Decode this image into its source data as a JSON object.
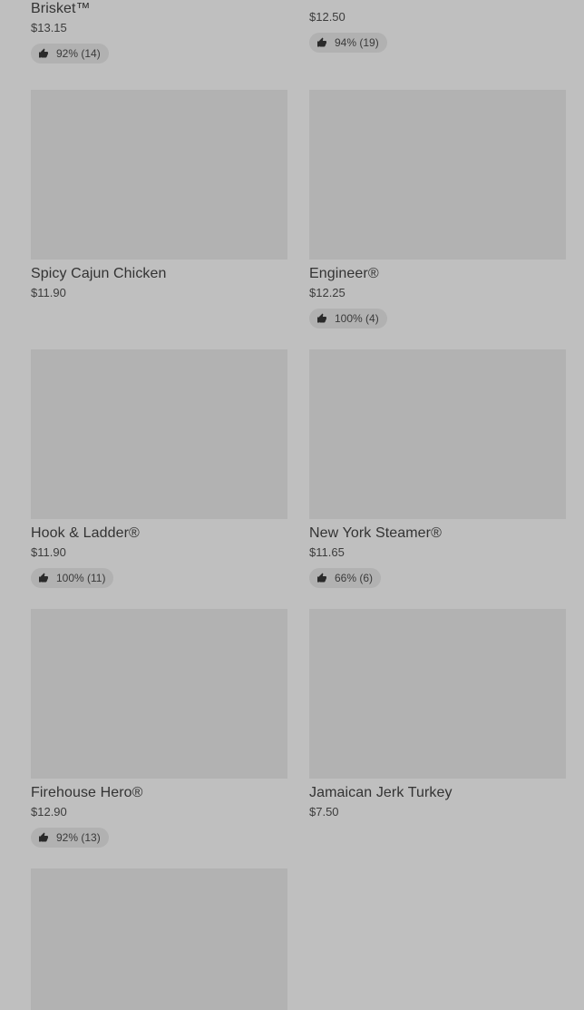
{
  "products": [
    {
      "name": "Brisket™",
      "price": "$13.15",
      "rating": "92% (14)"
    },
    {
      "name": "",
      "price": "$12.50",
      "rating": "94% (19)"
    },
    {
      "name": "Spicy Cajun Chicken",
      "price": "$11.90",
      "rating": null
    },
    {
      "name": "Engineer®",
      "price": "$12.25",
      "rating": "100% (4)"
    },
    {
      "name": "Hook & Ladder®",
      "price": "$11.90",
      "rating": "100% (11)"
    },
    {
      "name": "New York Steamer®",
      "price": "$11.65",
      "rating": "66% (6)"
    },
    {
      "name": "Firehouse Hero®",
      "price": "$12.90",
      "rating": "92% (13)"
    },
    {
      "name": "Jamaican Jerk Turkey",
      "price": "$7.50",
      "rating": null
    }
  ],
  "icons": {
    "rating": "thumbs-up-icon"
  },
  "colors": {
    "background": "#bfbfbf",
    "image_placeholder": "#b2b2b2",
    "badge": "#b1b1b1",
    "text": "#333333"
  }
}
